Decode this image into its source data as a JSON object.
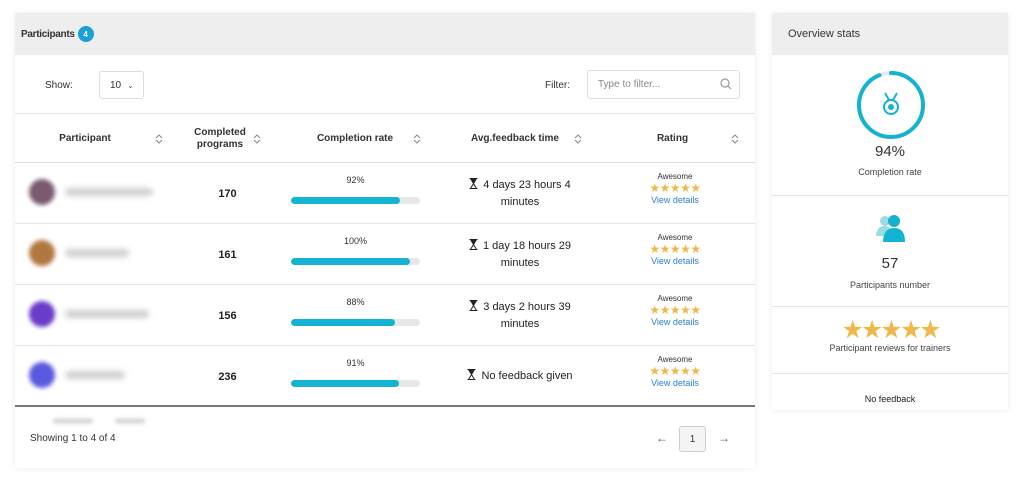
{
  "participants": {
    "title": "Participants",
    "count": "4",
    "show_label": "Show:",
    "show_value": "10",
    "filter_label": "Filter:",
    "filter_placeholder": "Type to filter...",
    "columns": [
      "Participant",
      "Completed programs",
      "Completion rate",
      "Avg.feedback time",
      "Rating"
    ],
    "rows": [
      {
        "programs": "170",
        "rate": "92%",
        "rate_value": 0.92,
        "feedback_line1": "4 days 23 hours 4",
        "feedback_line2": "minutes",
        "rating_label": "Awesome",
        "stars": "★★★★★",
        "link": "View details"
      },
      {
        "programs": "161",
        "rate": "100%",
        "rate_value": 1.0,
        "feedback_line1": "1 day 18 hours 29",
        "feedback_line2": "minutes",
        "rating_label": "Awesome",
        "stars": "★★★★★",
        "link": "View details"
      },
      {
        "programs": "156",
        "rate": "88%",
        "rate_value": 0.88,
        "feedback_line1": "3 days 2 hours 39",
        "feedback_line2": "minutes",
        "rating_label": "Awesome",
        "stars": "★★★★★",
        "link": "View details"
      },
      {
        "programs": "236",
        "rate": "91%",
        "rate_value": 0.91,
        "feedback_line1": "No feedback given",
        "feedback_line2": "",
        "rating_label": "Awesome",
        "stars": "★★★★★",
        "link": "View details"
      }
    ],
    "showing": "Showing 1 to 4 of 4",
    "prev": "←",
    "page": "1",
    "next": "→"
  },
  "overview": {
    "title": "Overview stats",
    "completion_value": "94%",
    "completion_label": "Completion rate",
    "participants_value": "57",
    "participants_label": "Participants number",
    "reviews_stars": "★★★★★",
    "reviews_label": "Participant reviews for trainers",
    "no_feedback": "No feedback"
  },
  "colors": {
    "accent": "#14b3d3",
    "badge": "#1c9fd8",
    "star": "#f0b84a",
    "link": "#2a7fd6"
  }
}
